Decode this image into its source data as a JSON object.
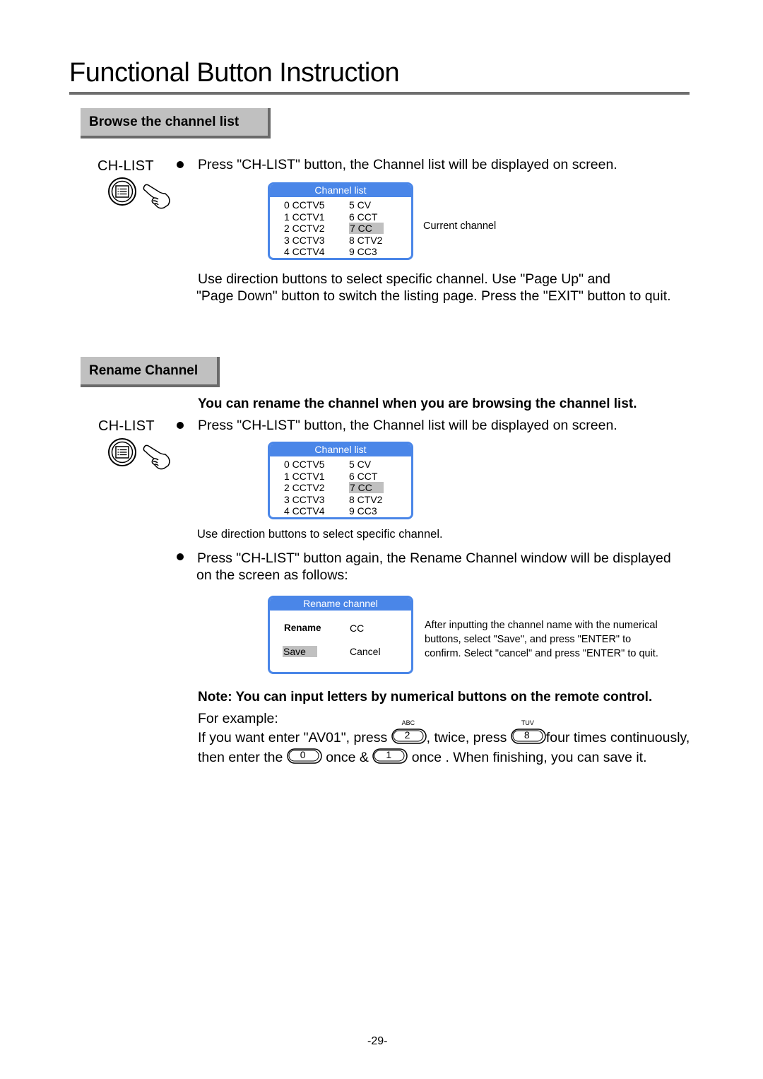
{
  "page": {
    "title": "Functional Button Instruction",
    "page_number": "-29-"
  },
  "browse_section": {
    "heading": "Browse the channel list",
    "button_label": "CH-LIST",
    "button_icon": "list-button-icon",
    "pointer_icon": "pointing-hand-icon",
    "instruction": "Press \"CH-LIST\" button, the Channel list will be displayed on screen.",
    "osd": {
      "title": "Channel list",
      "channels": [
        {
          "label": "0 CCTV5",
          "selected": false
        },
        {
          "label": "1 CCTV1",
          "selected": false
        },
        {
          "label": "2 CCTV2",
          "selected": false
        },
        {
          "label": "3 CCTV3",
          "selected": false
        },
        {
          "label": "4 CCTV4",
          "selected": false
        },
        {
          "label": "5 CV",
          "selected": false
        },
        {
          "label": "6 CCT",
          "selected": false
        },
        {
          "label": "7 CC",
          "selected": true
        },
        {
          "label": "8 CTV2",
          "selected": false
        },
        {
          "label": "9 CC3",
          "selected": false
        }
      ]
    },
    "current_channel_note": "Current channel",
    "description_line1": "Use direction buttons to select specific channel. Use \"Page Up\" and",
    "description_line2": "\"Page Down\" button to switch the listing page. Press the \"EXIT\" button to quit."
  },
  "rename_section": {
    "heading": "Rename Channel",
    "intro": "You can rename the channel when you are browsing the channel list.",
    "button_label": "CH-LIST",
    "instruction1": "Press \"CH-LIST\" button, the Channel list will be displayed on screen.",
    "osd": {
      "title": "Channel list",
      "channels": [
        {
          "label": "0 CCTV5",
          "selected": false
        },
        {
          "label": "1 CCTV1",
          "selected": false
        },
        {
          "label": "2 CCTV2",
          "selected": false
        },
        {
          "label": "3 CCTV3",
          "selected": false
        },
        {
          "label": "4 CCTV4",
          "selected": false
        },
        {
          "label": "5 CV",
          "selected": false
        },
        {
          "label": "6 CCT",
          "selected": false
        },
        {
          "label": "7 CC",
          "selected": true
        },
        {
          "label": "8 CTV2",
          "selected": false
        },
        {
          "label": "9 CC3",
          "selected": false
        }
      ]
    },
    "direction_note": "Use direction buttons to select specific channel.",
    "instruction2_line1": "Press \"CH-LIST\" button again, the Rename Channel window will be displayed",
    "instruction2_line2": "on the screen as follows:",
    "rename_osd": {
      "title": "Rename channel",
      "field_label": "Rename",
      "field_value": "CC",
      "save_label": "Save",
      "cancel_label": "Cancel",
      "selected": "Save"
    },
    "rename_note_line1": "After inputting the channel name with the numerical",
    "rename_note_line2": "buttons, select \"Save\", and press \"ENTER\" to",
    "rename_note_line3": "confirm. Select \"cancel\" and press \"ENTER\" to quit.",
    "note": "Note: You can input letters by numerical buttons on the remote control.",
    "example_label": "For example:",
    "example": {
      "l1_part1": "If you want enter \"AV01\", press",
      "key_2": {
        "digit": "2",
        "letters": "ABC"
      },
      "l1_part2": ", twice, press",
      "key_8": {
        "digit": "8",
        "letters": "TUV"
      },
      "l1_part3": "four times continuously,",
      "l2_part1": "then enter the",
      "key_0": {
        "digit": "0"
      },
      "l2_part2": "once &",
      "key_1": {
        "digit": "1"
      },
      "l2_part3": "once . When finishing, you can save it."
    }
  }
}
